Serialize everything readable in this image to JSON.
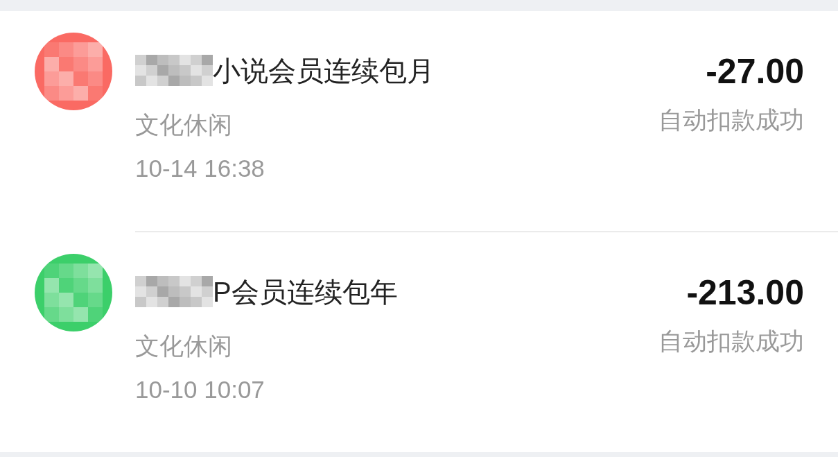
{
  "transactions": [
    {
      "title": "小说会员连续包月",
      "category": "文化休闲",
      "time": "10-14 16:38",
      "amount": "-27.00",
      "status": "自动扣款成功",
      "color": "#fa6a63"
    },
    {
      "title": "P会员连续包年",
      "category": "文化休闲",
      "time": "10-10 10:07",
      "amount": "-213.00",
      "status": "自动扣款成功",
      "color": "#3ccf6a"
    }
  ]
}
